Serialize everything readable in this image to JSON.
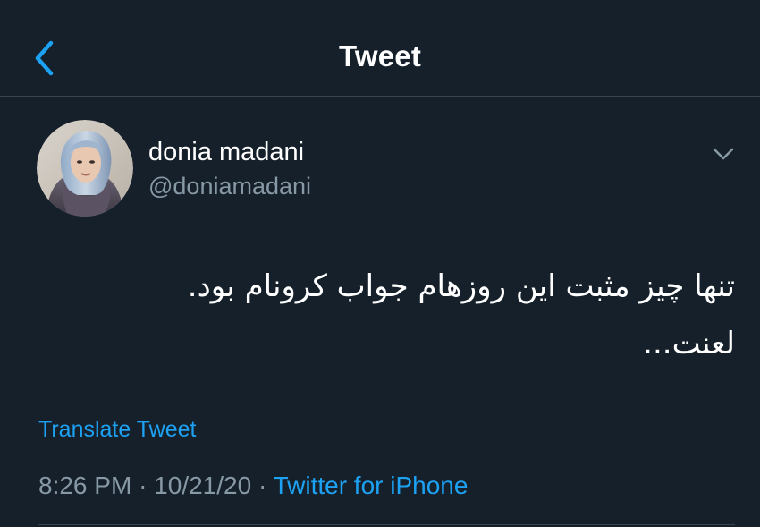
{
  "header": {
    "title": "Tweet",
    "back_icon": "chevron-left-icon"
  },
  "author": {
    "display_name": "donia madani",
    "username": "@doniamadani",
    "avatar_icon": "profile-photo"
  },
  "tweet": {
    "lines": [
      "تنها چیز مثبت این روزهام جواب کرونام بود.",
      "لعنت..."
    ],
    "menu_icon": "chevron-down-icon"
  },
  "translate_label": "Translate Tweet",
  "meta": {
    "time": "8:26 PM",
    "separator": "·",
    "date": "10/21/20",
    "source": "Twitter for iPhone"
  },
  "colors": {
    "background": "#15202b",
    "accent": "#1da1f2",
    "secondary_text": "#8899a6",
    "divider": "#38444d"
  }
}
